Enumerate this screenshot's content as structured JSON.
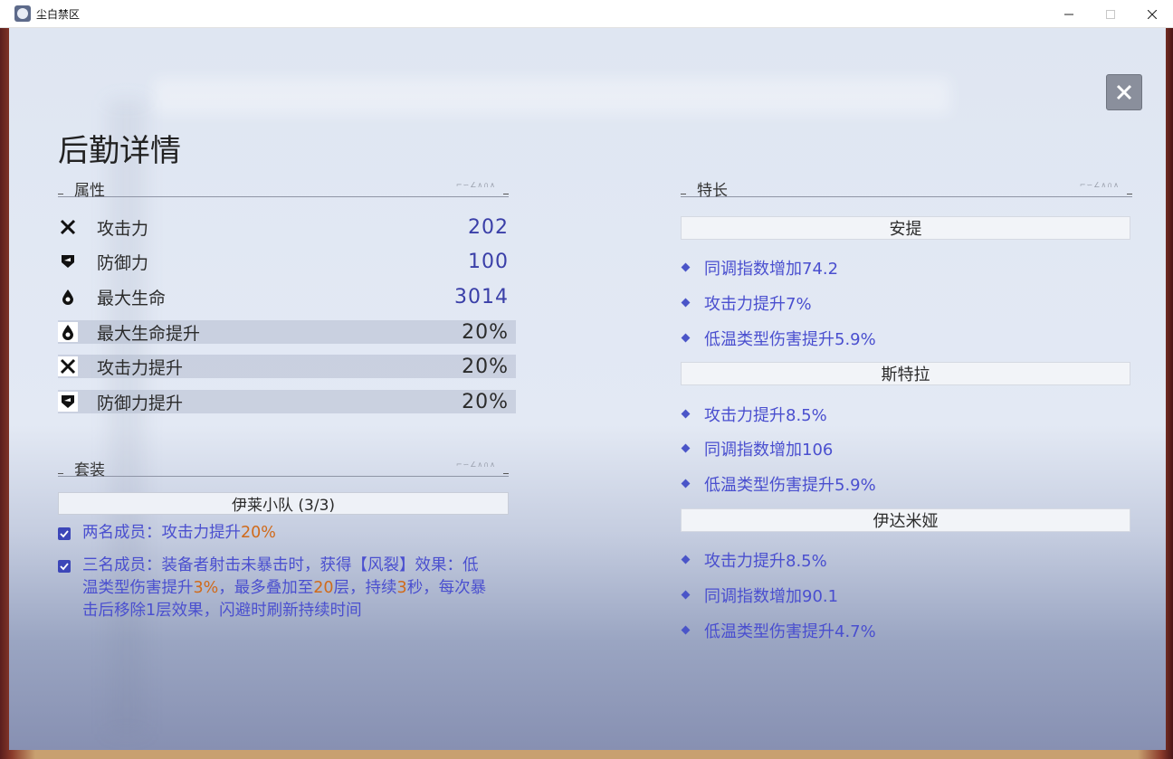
{
  "window": {
    "title": "尘白禁区"
  },
  "page": {
    "title": "后勤详情"
  },
  "attributes": {
    "section_label": "属性",
    "rows": [
      {
        "icon": "crossed-swords-icon",
        "name": "攻击力",
        "value": "202"
      },
      {
        "icon": "shield-icon",
        "name": "防御力",
        "value": "100"
      },
      {
        "icon": "drop-icon",
        "name": "最大生命",
        "value": "3014"
      },
      {
        "icon": "drop-icon",
        "name": "最大生命提升",
        "value": "20%"
      },
      {
        "icon": "crossed-swords-icon",
        "name": "攻击力提升",
        "value": "20%"
      },
      {
        "icon": "shield-icon",
        "name": "防御力提升",
        "value": "20%"
      }
    ]
  },
  "set": {
    "section_label": "套装",
    "name": "伊莱小队 (3/3)",
    "bonus1": {
      "pre": "两名成员：攻击力提升",
      "hl": "20%"
    },
    "bonus2": {
      "p1": "三名成员：装备者射击未暴击时，获得【风裂】效果：低温类型伤害提升",
      "h1": "3%",
      "p2": "，最多叠加至",
      "h2": "20",
      "p3": "层，持续",
      "h3": "3",
      "p4": "秒，每次暴击后移除1层效果，闪避时刷新持续时间"
    }
  },
  "specialties": {
    "section_label": "特长",
    "groups": [
      {
        "name": "安提",
        "items": [
          "同调指数增加74.2",
          "攻击力提升7%",
          "低温类型伤害提升5.9%"
        ]
      },
      {
        "name": "斯特拉",
        "items": [
          "攻击力提升8.5%",
          "同调指数增加106",
          "低温类型伤害提升5.9%"
        ]
      },
      {
        "name": "伊达米娅",
        "items": [
          "攻击力提升8.5%",
          "同调指数增加90.1",
          "低温类型伤害提升4.7%"
        ]
      }
    ]
  },
  "colors": {
    "accent": "#4a4fcf",
    "highlight": "#d06a1a",
    "value": "#3a3fa8"
  }
}
